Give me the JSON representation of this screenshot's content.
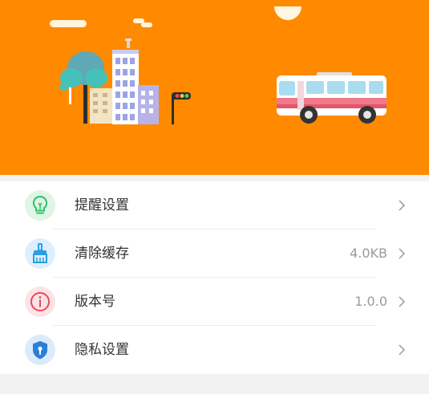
{
  "theme": {
    "banner_color": "#ff8a00",
    "list_background": "#ffffff",
    "page_background": "#f2f2f2"
  },
  "banner": {
    "illustration": "city-skyline-and-bus"
  },
  "settings": {
    "items": [
      {
        "label": "提醒设置",
        "value": "",
        "icon": "lightbulb-icon",
        "icon_color": "#2ec26a",
        "icon_bg": "#dff5e6"
      },
      {
        "label": "清除缓存",
        "value": "4.0KB",
        "icon": "broom-icon",
        "icon_color": "#2b9fe0",
        "icon_bg": "#dcefff"
      },
      {
        "label": "版本号",
        "value": "1.0.0",
        "icon": "info-icon",
        "icon_color": "#e8495b",
        "icon_bg": "#fde3e6"
      },
      {
        "label": "隐私设置",
        "value": "",
        "icon": "shield-lock-icon",
        "icon_color": "#2b7fd8",
        "icon_bg": "#dcebfb"
      }
    ]
  }
}
